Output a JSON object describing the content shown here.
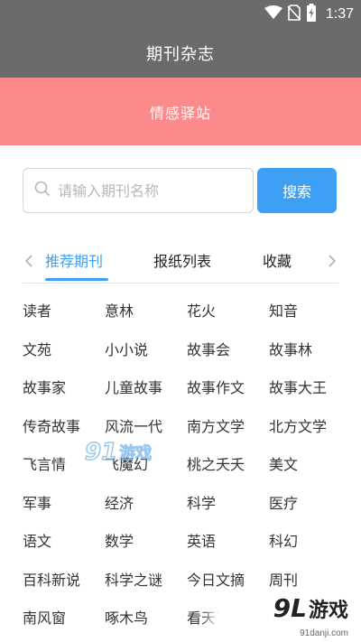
{
  "status_bar": {
    "time": "1:37"
  },
  "app_bar": {
    "title": "期刊杂志"
  },
  "banner": {
    "text": "情感驿站"
  },
  "search": {
    "placeholder": "请输入期刊名称",
    "value": "",
    "button_label": "搜索"
  },
  "tabs": [
    {
      "label": "推荐期刊",
      "active": true
    },
    {
      "label": "报纸列表",
      "active": false
    },
    {
      "label": "收藏",
      "active": false
    }
  ],
  "magazines": [
    "读者",
    "意林",
    "花火",
    "知音",
    "文苑",
    "小小说",
    "故事会",
    "故事林",
    "故事家",
    "儿童故事",
    "故事作文",
    "故事大王",
    "传奇故事",
    "风流一代",
    "南方文学",
    "北方文学",
    "飞言情",
    "飞魔幻",
    "桃之夭夭",
    "美文",
    "军事",
    "经济",
    "科学",
    "医疗",
    "语文",
    "数学",
    "英语",
    "科幻",
    "百科新说",
    "科学之谜",
    "今日文摘",
    "周刊",
    "南风窗",
    "啄木鸟",
    "看天下",
    ""
  ],
  "watermark": {
    "center_num": "91",
    "center_text": "游戏",
    "logo_num": "9L",
    "logo_text": "游戏",
    "url": "91danji.com"
  },
  "colors": {
    "header": "#6b6b6b",
    "banner": "#fd8a8a",
    "accent": "#3ea0f4"
  },
  "icons": [
    "wifi-icon",
    "no-sim-icon",
    "battery-charging-icon",
    "search-icon",
    "chevron-left-icon",
    "chevron-right-icon"
  ]
}
